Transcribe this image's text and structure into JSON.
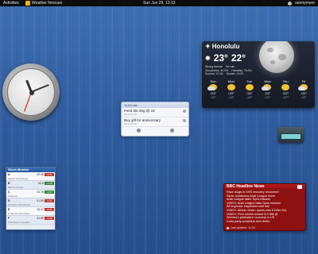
{
  "panel": {
    "activities": "Activities",
    "app_name": "Weather forecast",
    "clock": "Sun Jun 29, 13:13",
    "user": "seonymere"
  },
  "weather": {
    "city": "Honolulu",
    "current_temp": "23°",
    "feels_temp": "22°",
    "details": [
      [
        "Strong breeze",
        "No rain"
      ],
      [
        "Cloudiness: 40.0%",
        "Humidity: 76.0%"
      ],
      [
        "Sunrise: 07:00",
        "Sunset: 19:29"
      ]
    ],
    "forecast": [
      {
        "day": "Sun",
        "hi": "↑23°",
        "lo": "↓22°",
        "icon": "partly-cloudy-icon"
      },
      {
        "day": "Mon",
        "hi": "↑22°",
        "lo": "↓22°",
        "icon": "sun-icon"
      },
      {
        "day": "Tue",
        "hi": "↑22°",
        "lo": "↓22°",
        "icon": "sun-icon"
      },
      {
        "day": "Wed",
        "hi": "↑22°",
        "lo": "↓22°",
        "icon": "partly-cloudy-icon"
      },
      {
        "day": "Thu",
        "hi": "↑22°",
        "lo": "↓22°",
        "icon": "sun-icon"
      },
      {
        "day": "Fri",
        "hi": "↑22°",
        "lo": "↓22°",
        "icon": "partly-cloudy-icon"
      }
    ]
  },
  "todo": {
    "title": "To-Do list",
    "items": [
      {
        "text": "Feed the dog @ 16",
        "sub": "My to-do list"
      },
      {
        "text": "Buy gift for anniversary",
        "sub": "My to-do list"
      }
    ]
  },
  "stock": {
    "title": "Stock Monitor",
    "rows": [
      {
        "sym": "A",
        "price": "32.48",
        "chg": "-0.51",
        "dir": "down",
        "name": "Agilent Technology"
      },
      {
        "sym": "B",
        "price": "64.5",
        "chg": "+0.28",
        "dir": "up",
        "name": "Barnes Group"
      },
      {
        "sym": "C",
        "price": "24.76",
        "chg": "+0.07",
        "dir": "up",
        "name": "Citigroup"
      },
      {
        "sym": "D",
        "price": "51.80",
        "chg": "-0.31",
        "dir": "down",
        "name": "Dominion Resources"
      },
      {
        "sym": "E",
        "price": "16.47",
        "chg": "-0.26",
        "dir": "down",
        "name": "E.ON AG (Germany)"
      },
      {
        "sym": "F",
        "price": "31.89",
        "chg": "-0.19",
        "dir": "down",
        "name": "Ford Motor Compan"
      }
    ]
  },
  "news": {
    "title": "BBC Headline News",
    "lines": [
      "Fake drugs in NHS recovery recovered",
      "Syria: condemns Arab League move",
      "Arab League talks: Syria mission",
      "VIDEO: Arab League talks Syria mission",
      "IM inspector inspectors visit Iran",
      "VIDEO: African Union opens new £125m HQ",
      "VIDEO: Peru rebels restore 8-h title (8",
      "Women's protesters' recovery in US",
      "Cuba party considers term limits"
    ],
    "footer": "Last updated: 11:34"
  }
}
